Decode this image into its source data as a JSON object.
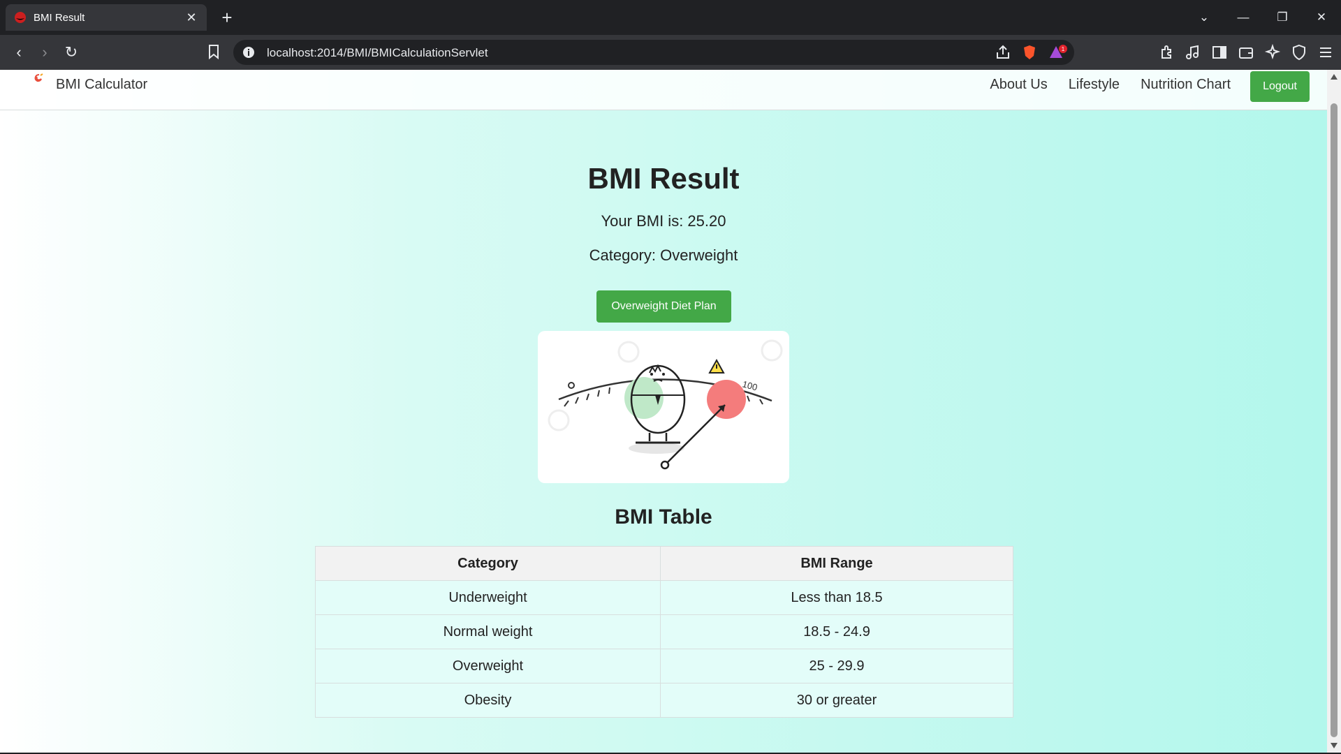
{
  "browser": {
    "tab_title": "BMI Result",
    "url": "localhost:2014/BMI/BMICalculationServlet",
    "badge_count": "1"
  },
  "navbar": {
    "brand": "BMI Calculator",
    "links": [
      "About Us",
      "Lifestyle",
      "Nutrition Chart"
    ],
    "logout": "Logout"
  },
  "result": {
    "title": "BMI Result",
    "bmi_text": "Your BMI is: 25.20",
    "category_text": "Category: Overweight",
    "diet_button": "Overweight Diet Plan",
    "illustration": {
      "scale_min_label": "0",
      "scale_max_label": "100"
    }
  },
  "table": {
    "title": "BMI Table",
    "headers": [
      "Category",
      "BMI Range"
    ],
    "rows": [
      [
        "Underweight",
        "Less than 18.5"
      ],
      [
        "Normal weight",
        "18.5 - 24.9"
      ],
      [
        "Overweight",
        "25 - 29.9"
      ],
      [
        "Obesity",
        "30 or greater"
      ]
    ]
  },
  "colors": {
    "accent_green": "#43a847",
    "background_gradient_end": "#b2f7ec"
  }
}
